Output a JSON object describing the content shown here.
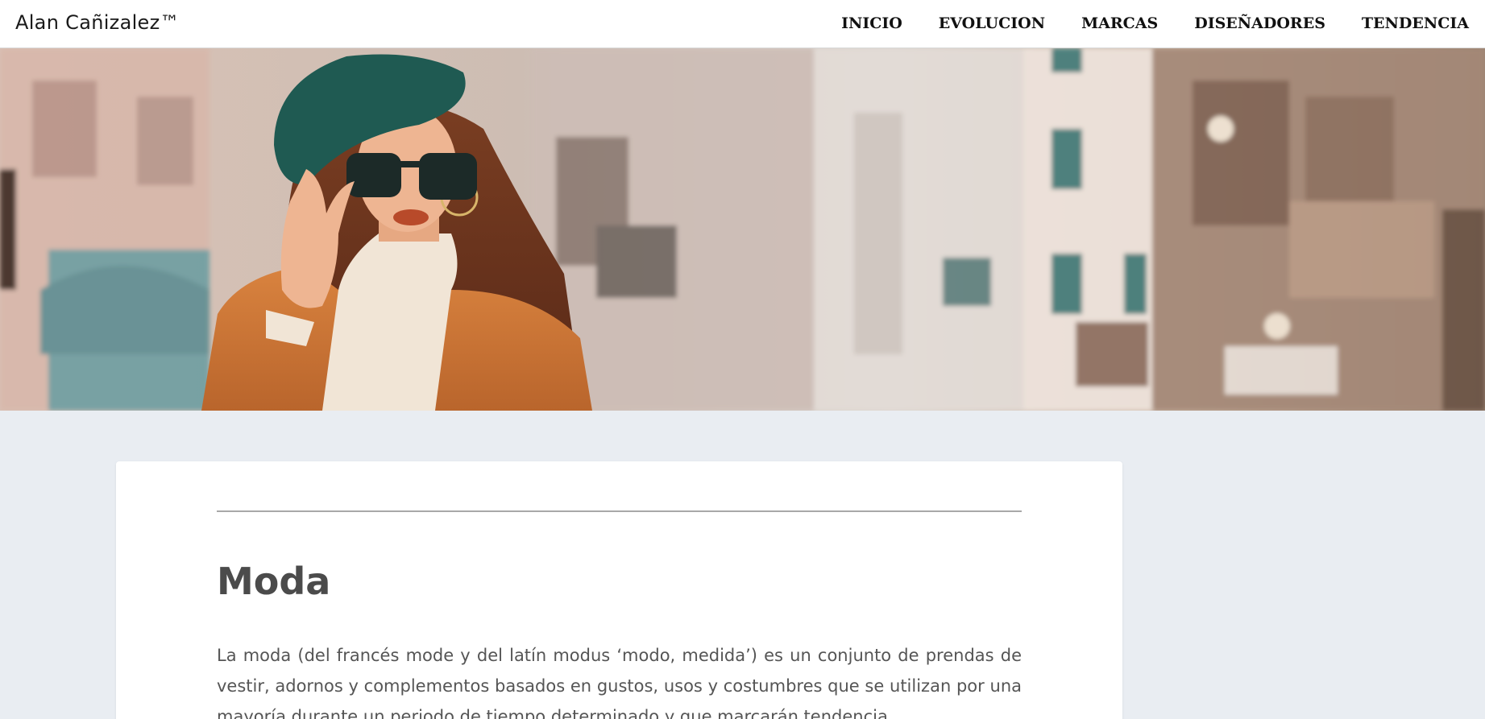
{
  "header": {
    "brand": "Alan Cañizalez™",
    "nav": [
      {
        "label": "INICIO"
      },
      {
        "label": "EVOLUCION"
      },
      {
        "label": "MARCAS"
      },
      {
        "label": "DISEÑADORES"
      },
      {
        "label": "TENDENCIA"
      }
    ]
  },
  "hero": {
    "image": "fashion-woman-street-photo"
  },
  "article": {
    "title": "Moda",
    "paragraph": "La moda (del francés mode y del latín modus ‘modo, medida’) es un conjunto de prendas de vestir, adornos y complementos basados en gustos, usos y costumbres que se utilizan por una mayoría durante un periodo de tiempo determinado y que marcarán tendencia"
  },
  "colors": {
    "page_background": "#e9edf2",
    "card_background": "#ffffff",
    "title_text": "#4b4b4b",
    "body_text": "#555555"
  }
}
